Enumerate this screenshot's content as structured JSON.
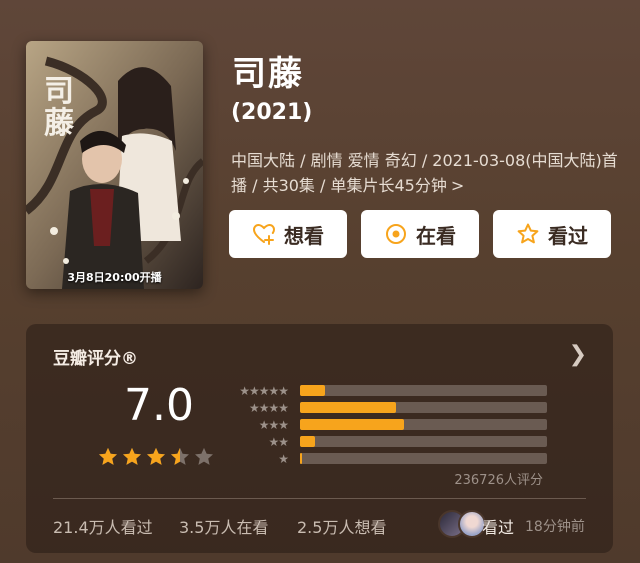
{
  "poster": {
    "art_text": "司藤",
    "caption": "3月8日20:00开播"
  },
  "title": "司藤",
  "year": "(2021)",
  "meta": "中国大陆 / 剧情 爱情 奇幻 / 2021-03-08(中国大陆)首播 / 共30集 / 单集片长45分钟",
  "meta_chevron": ">",
  "actions": {
    "want": {
      "label": "想看",
      "icon": "heart-plus-icon"
    },
    "watching": {
      "label": "在看",
      "icon": "target-circle-icon"
    },
    "watched": {
      "label": "看过",
      "icon": "star-outline-icon"
    }
  },
  "rating": {
    "header": "豆瓣评分®",
    "score": "7.0",
    "stars_out_of_5": 3.5,
    "distribution_fraction": [
      0.1,
      0.39,
      0.42,
      0.06,
      0.01
    ],
    "distribution_stars": [
      "★★★★★",
      "★★★★",
      "★★★",
      "★★",
      "★"
    ],
    "count": "236726人评分"
  },
  "stats": {
    "watched": "21.4万人看过",
    "watching": "3.5万人在看",
    "want": "2.5万人想看",
    "friend_action": "看过",
    "time": "18分钟前"
  },
  "colors": {
    "accent": "#f7a41c",
    "background": "#57402f",
    "card": "#3a2a21"
  }
}
